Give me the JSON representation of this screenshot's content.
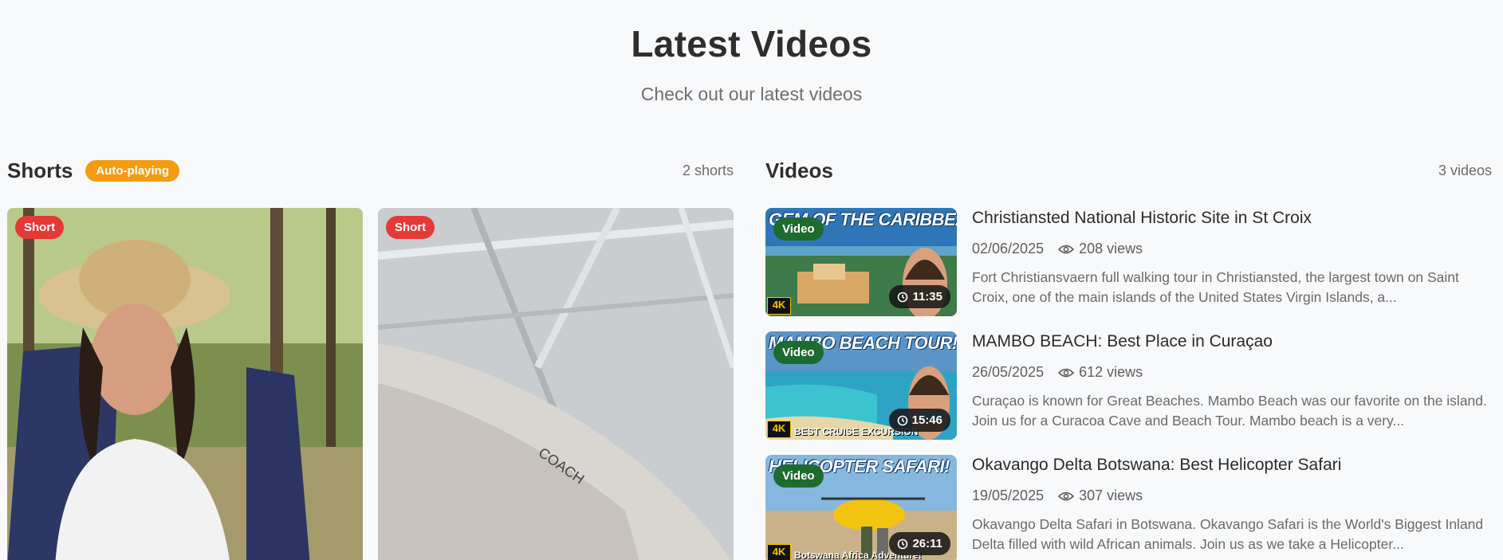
{
  "header": {
    "title": "Latest Videos",
    "subtitle": "Check out our latest videos"
  },
  "shorts": {
    "title": "Shorts",
    "autoplay_badge": "Auto-playing",
    "count": "2 shorts",
    "items": [
      {
        "badge": "Short"
      },
      {
        "badge": "Short"
      }
    ]
  },
  "videos": {
    "title": "Videos",
    "count": "3 videos",
    "items": [
      {
        "badge": "Video",
        "thumb_headline": "GEM OF THE CARIBBEAN!",
        "duration": "11:35",
        "title": "Christiansted National Historic Site in St Croix",
        "date": "02/06/2025",
        "views": "208 views",
        "description": "Fort Christiansvaern full walking tour in Christiansted, the largest town on Saint Croix, one of the main islands of the United States Virgin Islands, a..."
      },
      {
        "badge": "Video",
        "thumb_headline": "MAMBO BEACH TOUR!",
        "thumb_caption": "BEST CRUISE EXCURSION",
        "duration": "15:46",
        "title": "MAMBO BEACH: Best Place in Curaçao",
        "date": "26/05/2025",
        "views": "612 views",
        "description": "Curaçao is known for Great Beaches. Mambo Beach was our favorite on the island. Join us for a Curacoa Cave and Beach Tour. Mambo beach is a very..."
      },
      {
        "badge": "Video",
        "thumb_headline": "HELICOPTER SAFARI!",
        "thumb_caption": "Botswana Africa Adventure!",
        "duration": "26:11",
        "title": "Okavango Delta Botswana: Best Helicopter Safari",
        "date": "19/05/2025",
        "views": "307 views",
        "description": "Okavango Delta Safari in Botswana. Okavango Safari is the World's Biggest Inland Delta filled with wild African animals. Join us as we take a Helicopter..."
      }
    ]
  },
  "icons": {
    "views": "eye-icon",
    "duration": "clock-icon"
  },
  "colors": {
    "autoplay": "#f39c12",
    "short_badge": "#e53935",
    "video_badge": "#1e6b2f"
  }
}
